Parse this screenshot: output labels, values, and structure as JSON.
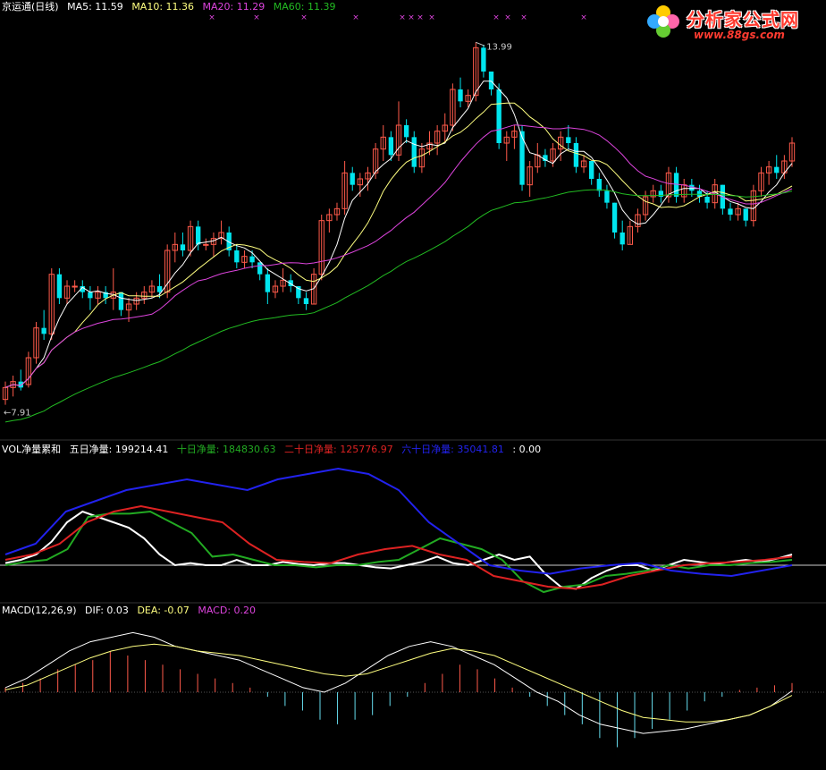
{
  "colors": {
    "up": "#ff5a4a",
    "down": "#00e5ee",
    "ma5": "#ffffff",
    "ma10": "#ffff80",
    "ma20": "#dd44dd",
    "ma60": "#22bb22",
    "vol_main": "#ffffff",
    "vol_10": "#22aa22",
    "vol_20": "#dd2222",
    "vol_60": "#2222ee",
    "macd_dif": "#ffffff",
    "macd_dea": "#ffff80",
    "macd_pos": "#ff5a4a",
    "macd_neg": "#66ddee"
  },
  "header_main": {
    "name": "京运通(日线)",
    "ma5": "MA5: 11.59",
    "ma10": "MA10: 11.36",
    "ma20": "MA20: 11.29",
    "ma60": "MA60: 11.39"
  },
  "header_vol": {
    "name": "VOL净量累和",
    "d5": "五日净量: 199214.41",
    "d10": "十日净量: 184830.63",
    "d20": "二十日净量: 125776.97",
    "d60": "六十日净量: 35041.81",
    "extra": ": 0.00"
  },
  "header_macd": {
    "name": "MACD(12,26,9)",
    "dif": "DIF: 0.03",
    "dea": "DEA: -0.07",
    "macd": "MACD: 0.20"
  },
  "annotations": {
    "high": "13.99",
    "low": "7.91"
  },
  "logo": {
    "title": "分析家公式网",
    "url": "www.88gs.com"
  },
  "chart_data": [
    {
      "type": "candlestick",
      "title": "京运通(日线)",
      "ylim": [
        7.5,
        14.4
      ],
      "candles": [
        [
          8.0,
          8.3,
          7.91,
          8.2
        ],
        [
          8.2,
          8.4,
          8.05,
          8.3
        ],
        [
          8.3,
          8.5,
          8.15,
          8.2
        ],
        [
          8.25,
          8.8,
          8.2,
          8.7
        ],
        [
          8.7,
          9.3,
          8.6,
          9.2
        ],
        [
          9.2,
          9.5,
          9.0,
          9.1
        ],
        [
          9.1,
          10.2,
          9.0,
          10.1
        ],
        [
          10.1,
          10.2,
          9.6,
          9.7
        ],
        [
          9.7,
          10.0,
          9.6,
          9.9
        ],
        [
          9.9,
          10.0,
          9.8,
          9.9
        ],
        [
          9.9,
          10.0,
          9.7,
          9.8
        ],
        [
          9.8,
          9.9,
          9.5,
          9.7
        ],
        [
          9.7,
          9.9,
          9.6,
          9.8
        ],
        [
          9.8,
          9.9,
          9.6,
          9.7
        ],
        [
          9.7,
          10.2,
          9.5,
          9.8
        ],
        [
          9.8,
          9.8,
          9.4,
          9.5
        ],
        [
          9.5,
          9.7,
          9.3,
          9.6
        ],
        [
          9.6,
          9.8,
          9.5,
          9.7
        ],
        [
          9.7,
          9.9,
          9.6,
          9.8
        ],
        [
          9.8,
          10.0,
          9.7,
          9.9
        ],
        [
          9.9,
          10.1,
          9.7,
          9.8
        ],
        [
          9.8,
          10.6,
          9.7,
          10.5
        ],
        [
          10.5,
          10.8,
          10.3,
          10.6
        ],
        [
          10.6,
          10.8,
          10.4,
          10.5
        ],
        [
          10.5,
          11.0,
          10.4,
          10.9
        ],
        [
          10.9,
          11.0,
          10.5,
          10.6
        ],
        [
          10.6,
          10.7,
          10.5,
          10.6
        ],
        [
          10.6,
          10.8,
          10.4,
          10.7
        ],
        [
          10.7,
          11.0,
          10.6,
          10.8
        ],
        [
          10.8,
          10.9,
          10.4,
          10.5
        ],
        [
          10.5,
          10.6,
          10.2,
          10.3
        ],
        [
          10.3,
          10.5,
          10.2,
          10.4
        ],
        [
          10.4,
          10.5,
          10.2,
          10.3
        ],
        [
          10.3,
          10.3,
          10.0,
          10.1
        ],
        [
          10.1,
          10.2,
          9.6,
          9.8
        ],
        [
          9.8,
          10.0,
          9.7,
          9.9
        ],
        [
          9.9,
          10.2,
          9.8,
          10.0
        ],
        [
          10.0,
          10.1,
          9.8,
          9.9
        ],
        [
          9.9,
          9.9,
          9.6,
          9.7
        ],
        [
          9.7,
          9.8,
          9.5,
          9.6
        ],
        [
          9.6,
          10.2,
          9.6,
          10.1
        ],
        [
          10.1,
          11.1,
          10.0,
          11.0
        ],
        [
          11.0,
          11.2,
          10.8,
          11.1
        ],
        [
          11.1,
          11.3,
          11.0,
          11.2
        ],
        [
          11.2,
          12.0,
          11.1,
          11.8
        ],
        [
          11.8,
          11.9,
          11.5,
          11.6
        ],
        [
          11.6,
          11.8,
          11.4,
          11.7
        ],
        [
          11.7,
          11.9,
          11.5,
          11.8
        ],
        [
          11.8,
          12.3,
          11.7,
          12.2
        ],
        [
          12.2,
          12.6,
          12.0,
          12.4
        ],
        [
          12.4,
          12.5,
          12.0,
          12.1
        ],
        [
          12.1,
          13.0,
          12.0,
          12.6
        ],
        [
          12.6,
          12.7,
          12.3,
          12.4
        ],
        [
          12.4,
          12.5,
          11.8,
          11.9
        ],
        [
          11.9,
          12.3,
          11.8,
          12.2
        ],
        [
          12.2,
          12.5,
          12.1,
          12.3
        ],
        [
          12.3,
          12.6,
          12.1,
          12.5
        ],
        [
          12.5,
          12.8,
          12.3,
          12.6
        ],
        [
          12.6,
          13.3,
          12.5,
          13.2
        ],
        [
          13.2,
          13.4,
          12.9,
          13.0
        ],
        [
          13.0,
          13.2,
          12.9,
          13.1
        ],
        [
          13.1,
          13.99,
          13.0,
          13.9
        ],
        [
          13.9,
          13.95,
          13.4,
          13.5
        ],
        [
          13.5,
          13.5,
          13.1,
          13.2
        ],
        [
          13.2,
          13.3,
          12.2,
          12.3
        ],
        [
          12.3,
          12.5,
          12.0,
          12.4
        ],
        [
          12.4,
          12.6,
          12.2,
          12.5
        ],
        [
          12.5,
          12.6,
          11.5,
          11.6
        ],
        [
          11.6,
          12.0,
          11.4,
          11.9
        ],
        [
          11.9,
          12.3,
          11.8,
          12.1
        ],
        [
          12.1,
          12.2,
          11.9,
          12.0
        ],
        [
          12.0,
          12.3,
          11.9,
          12.2
        ],
        [
          12.2,
          12.5,
          12.0,
          12.4
        ],
        [
          12.4,
          12.6,
          12.2,
          12.3
        ],
        [
          12.3,
          12.4,
          11.8,
          11.9
        ],
        [
          11.9,
          12.1,
          11.8,
          12.0
        ],
        [
          12.0,
          12.0,
          11.6,
          11.7
        ],
        [
          11.7,
          11.8,
          11.4,
          11.5
        ],
        [
          11.5,
          11.6,
          11.2,
          11.3
        ],
        [
          11.3,
          11.3,
          10.7,
          10.8
        ],
        [
          10.8,
          11.0,
          10.5,
          10.6
        ],
        [
          10.6,
          11.0,
          10.6,
          10.9
        ],
        [
          10.9,
          11.2,
          10.8,
          11.1
        ],
        [
          11.1,
          11.5,
          11.0,
          11.4
        ],
        [
          11.4,
          11.6,
          11.3,
          11.5
        ],
        [
          11.5,
          11.6,
          11.3,
          11.4
        ],
        [
          11.4,
          11.9,
          11.3,
          11.8
        ],
        [
          11.8,
          11.9,
          11.3,
          11.4
        ],
        [
          11.4,
          11.7,
          11.3,
          11.6
        ],
        [
          11.6,
          11.7,
          11.4,
          11.5
        ],
        [
          11.5,
          11.6,
          11.3,
          11.4
        ],
        [
          11.4,
          11.5,
          11.2,
          11.3
        ],
        [
          11.3,
          11.7,
          11.2,
          11.6
        ],
        [
          11.6,
          11.6,
          11.1,
          11.2
        ],
        [
          11.2,
          11.3,
          11.0,
          11.1
        ],
        [
          11.1,
          11.3,
          11.0,
          11.2
        ],
        [
          11.2,
          11.2,
          10.9,
          11.0
        ],
        [
          11.0,
          11.6,
          10.9,
          11.5
        ],
        [
          11.5,
          11.9,
          11.4,
          11.8
        ],
        [
          11.8,
          12.0,
          11.6,
          11.9
        ],
        [
          11.9,
          12.1,
          11.7,
          11.8
        ],
        [
          11.8,
          12.1,
          11.7,
          12.0
        ],
        [
          12.0,
          12.4,
          11.9,
          12.3
        ]
      ],
      "ma_periods": [
        5,
        10,
        20,
        60
      ],
      "ma60_start": 7.6,
      "star_markers_x": [
        237,
        287,
        340,
        398,
        450,
        460,
        470,
        483,
        555,
        568,
        586,
        653,
        731,
        812,
        890
      ]
    },
    {
      "type": "line",
      "title": "VOL净量累和",
      "ylim": [
        -30,
        100
      ],
      "series": [
        {
          "name": "五日净量",
          "color_key": "vol_main",
          "values": [
            2,
            5,
            10,
            22,
            40,
            50,
            45,
            40,
            35,
            25,
            10,
            0,
            2,
            0,
            0,
            5,
            0,
            0,
            3,
            1,
            0,
            2,
            2,
            0,
            -2,
            -3,
            0,
            3,
            8,
            2,
            0,
            5,
            10,
            5,
            8,
            -8,
            -20,
            -22,
            -12,
            -5,
            0,
            0,
            -5,
            0,
            5,
            3,
            1,
            3,
            5,
            3,
            6,
            10
          ]
        },
        {
          "name": "十日净量",
          "color_key": "vol_10",
          "values": [
            0,
            3,
            5,
            15,
            45,
            48,
            48,
            50,
            40,
            30,
            8,
            10,
            5,
            0,
            0,
            -2,
            0,
            0,
            3,
            5,
            15,
            25,
            20,
            15,
            5,
            -15,
            -25,
            -20,
            -18,
            -10,
            -8,
            -5,
            0,
            -3,
            0,
            0,
            2,
            3,
            5
          ]
        },
        {
          "name": "二十日净量",
          "color_key": "vol_20",
          "values": [
            5,
            10,
            20,
            40,
            50,
            55,
            50,
            45,
            40,
            20,
            5,
            3,
            2,
            10,
            15,
            18,
            10,
            5,
            -10,
            -15,
            -20,
            -22,
            -18,
            -10,
            -5,
            0,
            2,
            3,
            5,
            8
          ]
        },
        {
          "name": "六十日净量",
          "color_key": "vol_60",
          "values": [
            10,
            20,
            50,
            60,
            70,
            75,
            80,
            75,
            70,
            80,
            85,
            90,
            85,
            70,
            40,
            20,
            0,
            -5,
            -8,
            -3,
            0,
            2,
            -5,
            -8,
            -10,
            -5,
            0
          ]
        }
      ]
    },
    {
      "type": "bar",
      "title": "MACD(12,26,9)",
      "ylim": [
        -1.6,
        1.6
      ],
      "values": [
        0.1,
        0.2,
        0.3,
        0.5,
        0.6,
        0.7,
        0.9,
        0.8,
        0.7,
        0.6,
        0.5,
        0.4,
        0.3,
        0.2,
        0.1,
        -0.1,
        -0.3,
        -0.4,
        -0.6,
        -0.7,
        -0.6,
        -0.5,
        -0.3,
        -0.1,
        0.2,
        0.4,
        0.6,
        0.5,
        0.3,
        0.1,
        -0.1,
        -0.3,
        -0.5,
        -0.7,
        -1.0,
        -1.2,
        -1.0,
        -0.8,
        -0.6,
        -0.4,
        -0.2,
        -0.1,
        0.05,
        0.1,
        0.15,
        0.2
      ],
      "dif": [
        0.1,
        0.3,
        0.6,
        0.9,
        1.1,
        1.2,
        1.3,
        1.2,
        1.0,
        0.9,
        0.8,
        0.7,
        0.5,
        0.3,
        0.1,
        0.0,
        0.2,
        0.5,
        0.8,
        1.0,
        1.1,
        1.0,
        0.8,
        0.6,
        0.3,
        0.0,
        -0.2,
        -0.5,
        -0.7,
        -0.8,
        -0.9,
        -0.85,
        -0.8,
        -0.7,
        -0.6,
        -0.5,
        -0.3,
        0.03
      ],
      "dea": [
        0.05,
        0.15,
        0.35,
        0.55,
        0.75,
        0.9,
        1.0,
        1.05,
        1.0,
        0.9,
        0.85,
        0.8,
        0.7,
        0.6,
        0.5,
        0.4,
        0.35,
        0.4,
        0.55,
        0.7,
        0.85,
        0.95,
        0.9,
        0.8,
        0.6,
        0.4,
        0.2,
        0.0,
        -0.2,
        -0.4,
        -0.55,
        -0.6,
        -0.65,
        -0.65,
        -0.6,
        -0.5,
        -0.3,
        -0.07
      ]
    }
  ]
}
